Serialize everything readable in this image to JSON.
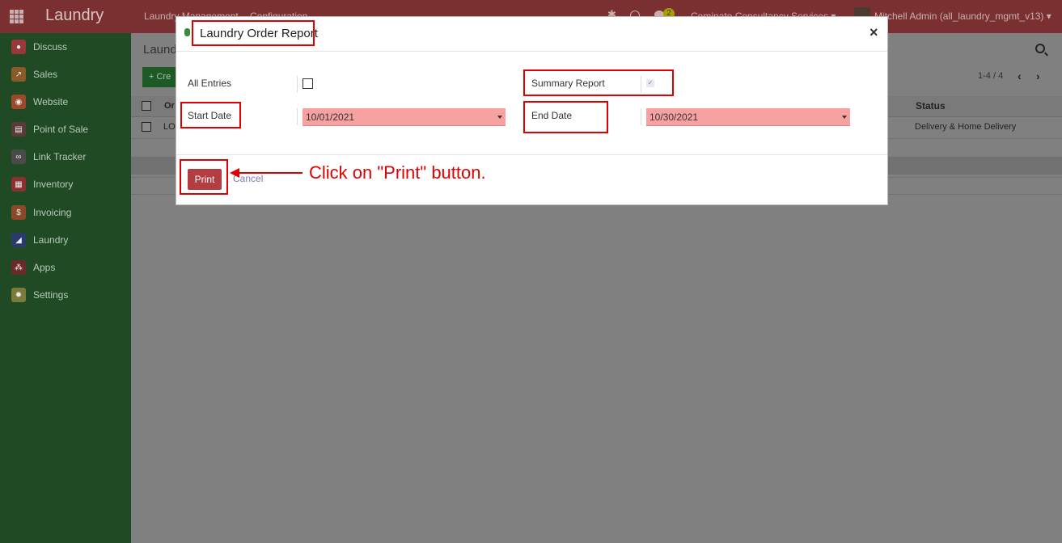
{
  "navbar": {
    "app_name": "Laundry",
    "menu": [
      "Laundry Management",
      "Configuration"
    ],
    "badge_count": "2",
    "company": "Cominato Consultancy Services",
    "user": "Mitchell Admin (all_laundry_mgmt_v13)"
  },
  "sidebar": {
    "items": [
      {
        "label": "Discuss",
        "icon": "discuss-icon",
        "color": "#9a3838"
      },
      {
        "label": "Sales",
        "icon": "sales-icon",
        "color": "#8a5a2a"
      },
      {
        "label": "Website",
        "icon": "website-icon",
        "color": "#9a4a2a"
      },
      {
        "label": "Point of Sale",
        "icon": "pos-icon",
        "color": "#5a3a3a"
      },
      {
        "label": "Link Tracker",
        "icon": "link-icon",
        "color": "#4a4a4a"
      },
      {
        "label": "Inventory",
        "icon": "inventory-icon",
        "color": "#8a3030"
      },
      {
        "label": "Invoicing",
        "icon": "invoicing-icon",
        "color": "#8a4a2a"
      },
      {
        "label": "Laundry",
        "icon": "laundry-icon",
        "color": "#2a3a6a"
      },
      {
        "label": "Apps",
        "icon": "apps-icon",
        "color": "#6a2a2a"
      },
      {
        "label": "Settings",
        "icon": "settings-icon",
        "color": "#7a7a3a"
      }
    ]
  },
  "main": {
    "title": "Laund",
    "create_label": "Cre",
    "pager": "1-4 / 4",
    "col_order": "Or",
    "col_status": "Status",
    "row_order": "LO",
    "row_status": "Delivery & Home Delivery"
  },
  "dialog": {
    "title": "Laundry Order Report",
    "close": "×",
    "all_entries_label": "All Entries",
    "summary_label": "Summary Report",
    "start_label": "Start Date",
    "end_label": "End Date",
    "start_value": "10/01/2021",
    "end_value": "10/30/2021",
    "print_label": "Print",
    "cancel_label": "Cancel"
  },
  "annotation": {
    "text": "Click on \"Print\" button."
  },
  "colors": {
    "highlight": "#e00000",
    "print_button": "#b43d41",
    "required_field": "#f7a1a1"
  }
}
